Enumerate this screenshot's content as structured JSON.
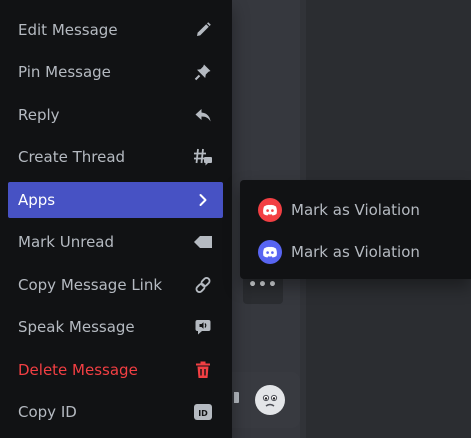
{
  "colors": {
    "menu_bg": "#111214",
    "text": "#b5bac1",
    "selected_bg": "#4752c4",
    "danger": "#f23f43",
    "app_red": "#f23f43",
    "app_blue": "#5865f2"
  },
  "menu": {
    "items": [
      {
        "label": "Edit Message",
        "icon": "pencil-icon"
      },
      {
        "label": "Pin Message",
        "icon": "pin-icon"
      },
      {
        "label": "Reply",
        "icon": "reply-arrow-icon"
      },
      {
        "label": "Create Thread",
        "icon": "thread-icon"
      },
      {
        "label": "Apps",
        "icon": "chevron-right-icon",
        "selected": true
      },
      {
        "label": "Mark Unread",
        "icon": "unread-tag-icon"
      },
      {
        "label": "Copy Message Link",
        "icon": "link-icon"
      },
      {
        "label": "Speak Message",
        "icon": "speaker-bubble-icon"
      },
      {
        "label": "Delete Message",
        "icon": "trash-icon",
        "danger": true
      },
      {
        "label": "Copy ID",
        "icon": "id-badge-icon"
      }
    ]
  },
  "apps_submenu": {
    "items": [
      {
        "label": "Mark as Violation",
        "icon": "discord-app-red-icon"
      },
      {
        "label": "Mark as Violation",
        "icon": "discord-app-blue-icon"
      }
    ]
  },
  "background": {
    "overflow_button_glyph": "•••"
  }
}
